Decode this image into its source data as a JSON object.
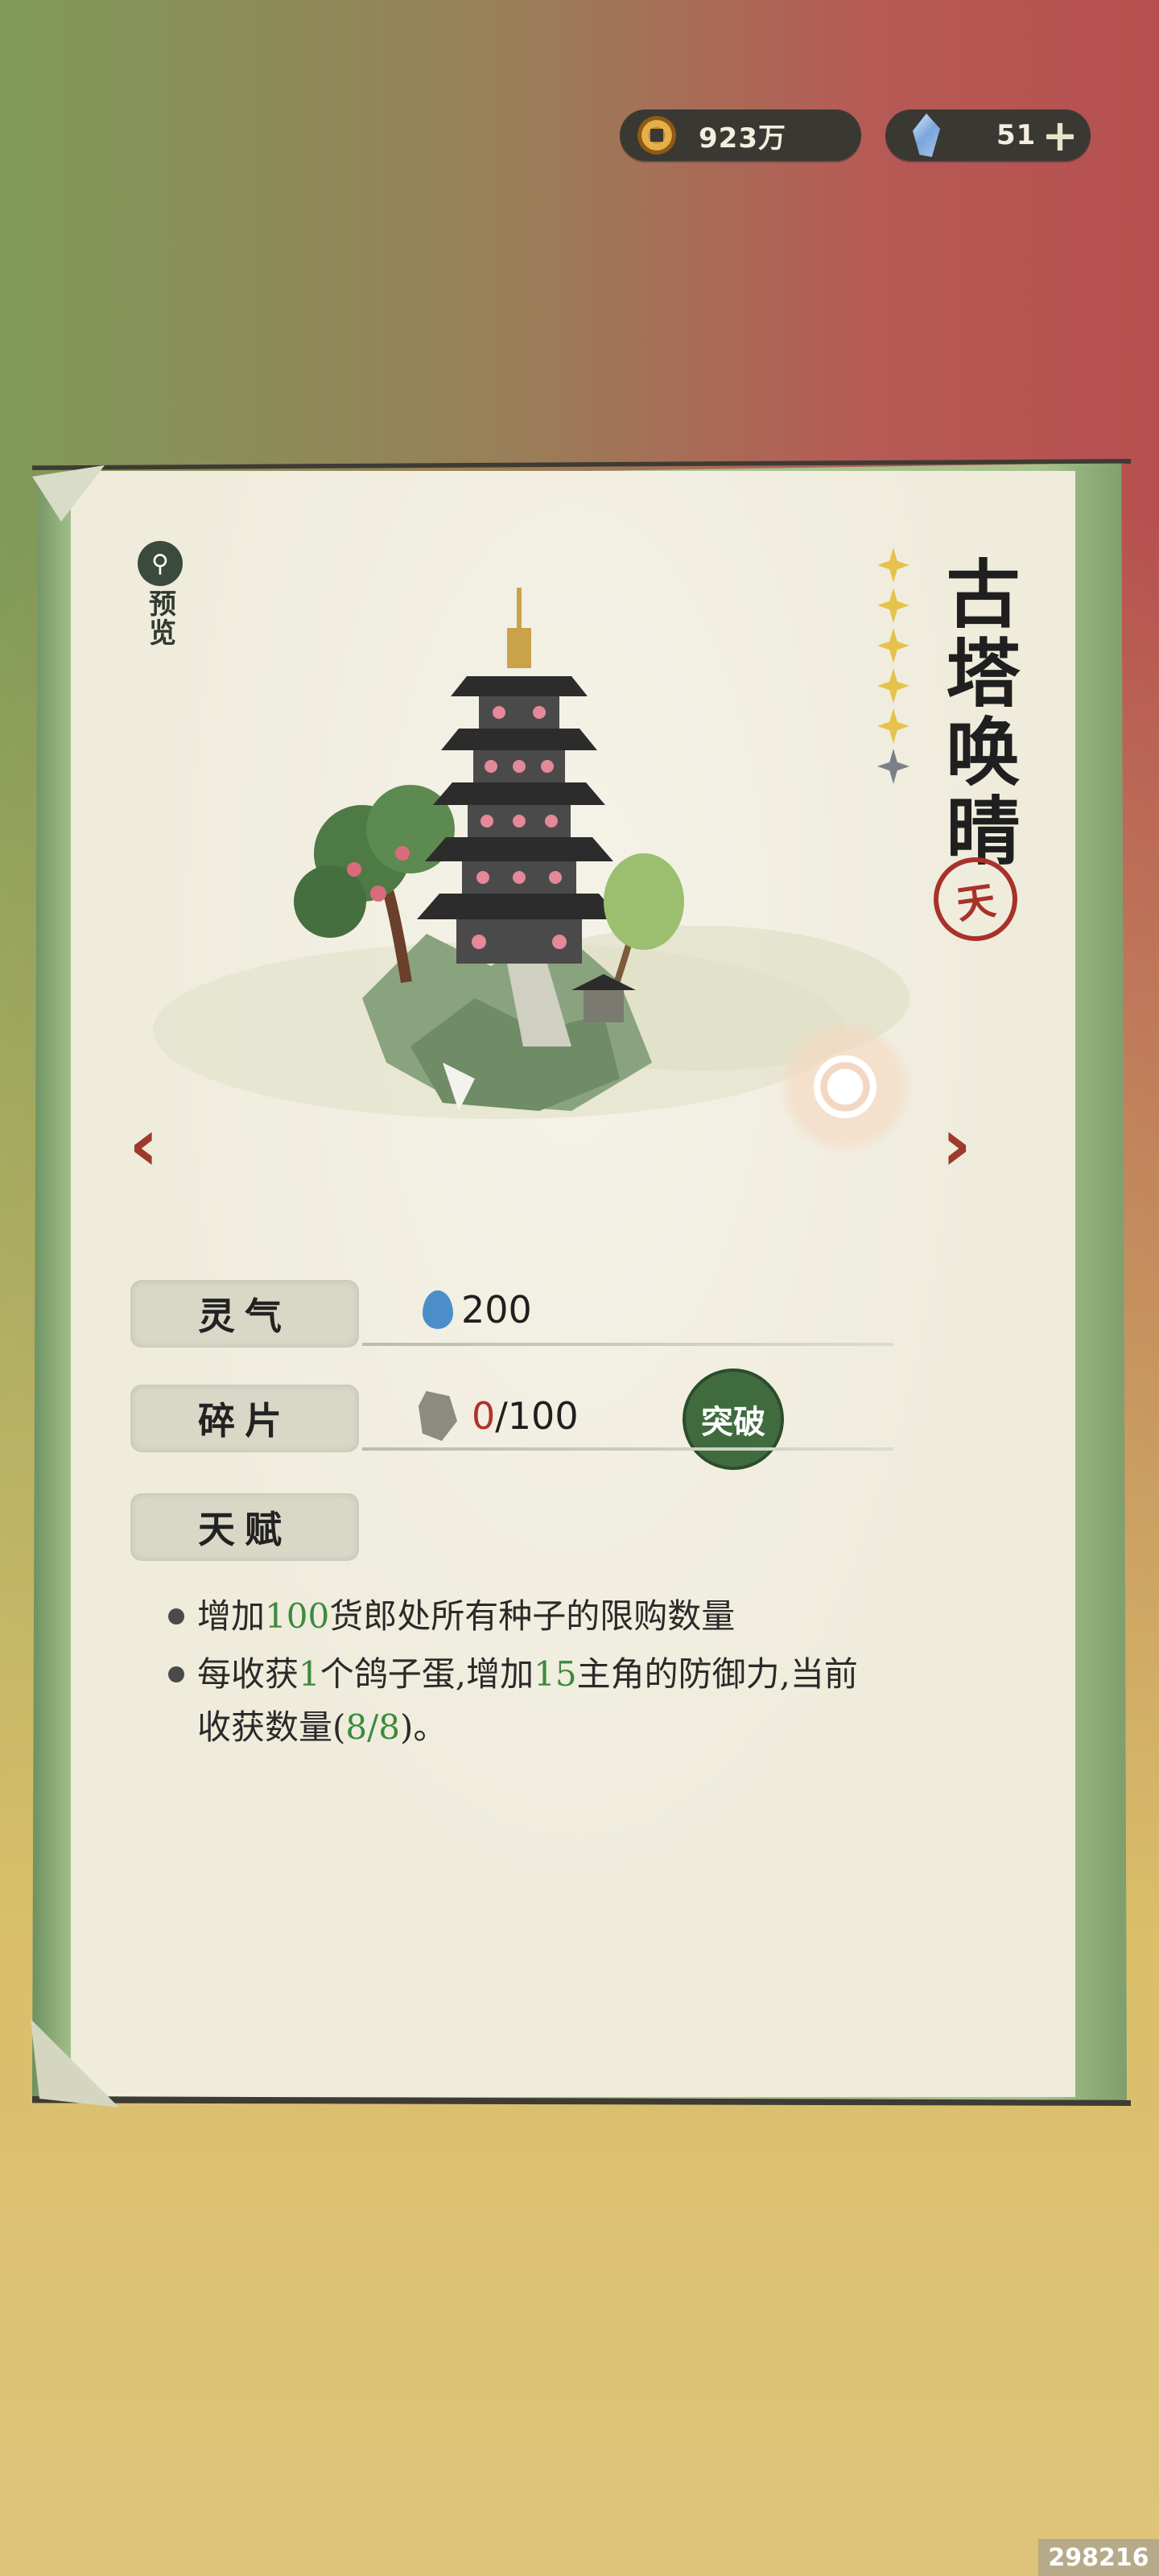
{
  "currency": {
    "coins": "923万",
    "gems": "51",
    "coin_icon": "copper-coin-icon",
    "gem_icon": "crystal-gem-icon",
    "plus": "+"
  },
  "preview": {
    "icon": "magnifier-icon",
    "label": "预览"
  },
  "building": {
    "name": "古塔唤晴",
    "grade": "天",
    "stars_filled": 5,
    "stars_total": 6
  },
  "stats": {
    "aura_label": "灵气",
    "aura_value": "200",
    "fragment_label": "碎片",
    "fragment_have": "0",
    "fragment_need": "/100",
    "breakthrough_label": "突破",
    "talent_label": "天赋"
  },
  "talents": [
    {
      "t1": "增加",
      "n1": "100",
      "t2": "货郎处所有种子的限购数量"
    },
    {
      "t1": "每收获",
      "n1": "1",
      "t2": "个鸽子蛋,增加",
      "n2": "15",
      "t3": "主角的防御力,当前收获数量(",
      "n3": "8/8",
      "t4": ")。"
    }
  ],
  "nav": {
    "prev": "‹",
    "next": "›"
  },
  "watermark": "298216",
  "colors": {
    "accent_red": "#9c3a2c",
    "green": "#3d8a3d",
    "star_gold": "#e5c34a"
  }
}
